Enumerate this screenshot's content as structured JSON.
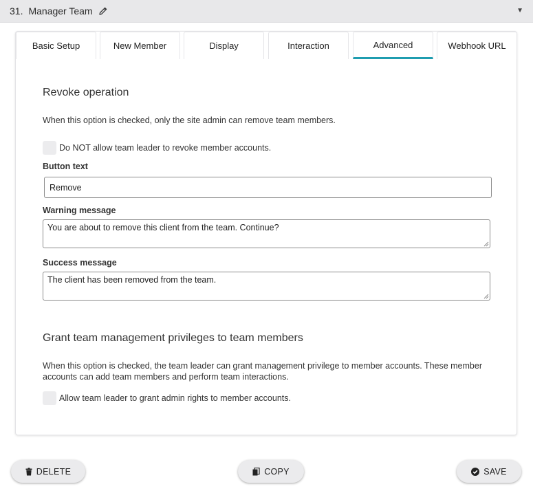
{
  "header": {
    "number": "31.",
    "title": "Manager Team",
    "edit_icon": "pencil-icon",
    "toggle_icon": "caret-down-icon"
  },
  "tabs": [
    {
      "label": "Basic Setup",
      "active": false
    },
    {
      "label": "New Member",
      "active": false
    },
    {
      "label": "Display",
      "active": false
    },
    {
      "label": "Interaction",
      "active": false
    },
    {
      "label": "Advanced",
      "active": true
    },
    {
      "label": "Webhook URL",
      "active": false
    }
  ],
  "accent_color": "#1f9db0",
  "revoke": {
    "title": "Revoke operation",
    "description": "When this option is checked, only the site admin can remove team members.",
    "checkbox_label": "Do NOT allow team leader to revoke member accounts.",
    "checked": false,
    "button_text_label": "Button text",
    "button_text_value": "Remove",
    "warning_label": "Warning message",
    "warning_value": "You are about to remove this client from the team. Continue?",
    "success_label": "Success message",
    "success_value": "The client has been removed from the team."
  },
  "grant": {
    "title": "Grant team management privileges to team members",
    "description": "When this option is checked, the team leader can grant management privilege to member accounts. These member accounts can add team members and perform team interactions.",
    "checkbox_label": "Allow team leader to grant admin rights to member accounts.",
    "checked": false
  },
  "actions": {
    "delete_label": "DELETE",
    "copy_label": "COPY",
    "save_label": "SAVE"
  }
}
